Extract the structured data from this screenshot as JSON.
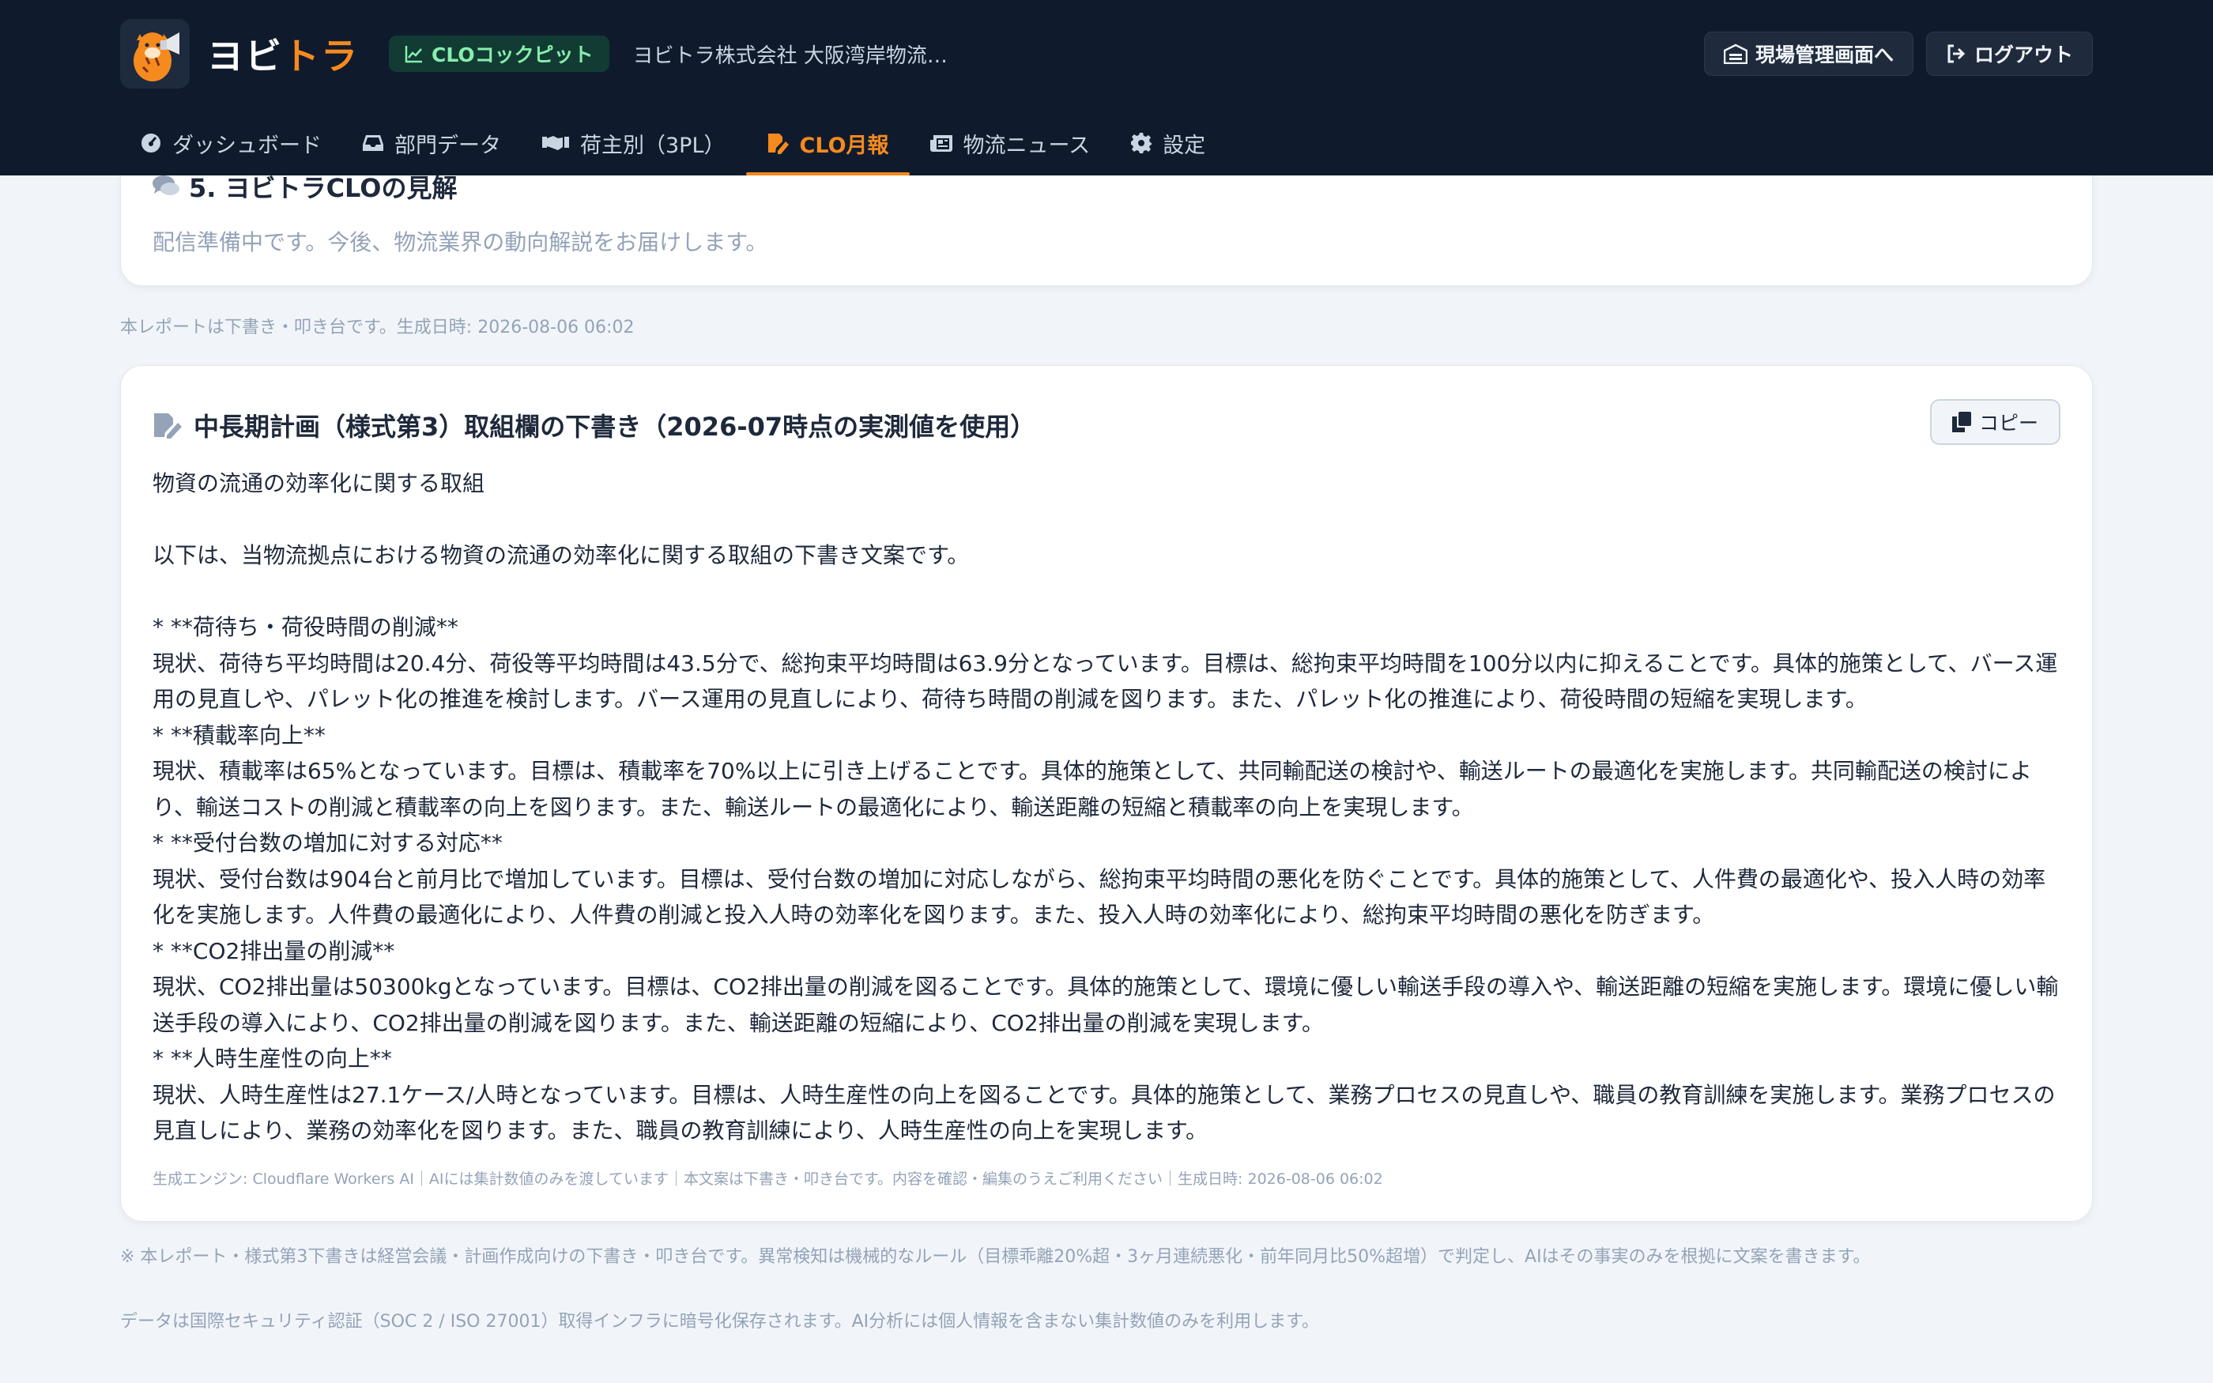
{
  "header": {
    "brand_part1": "ヨビ",
    "brand_part2": "トラ",
    "badge_label": "CLOコックピット",
    "company": "ヨビトラ株式会社 大阪湾岸物流セ...",
    "site_button": "現場管理画面へ",
    "logout_button": "ログアウト"
  },
  "nav": {
    "items": [
      {
        "label": "ダッシュボード",
        "icon": "gauge-icon"
      },
      {
        "label": "部門データ",
        "icon": "inbox-icon"
      },
      {
        "label": "荷主別（3PL）",
        "icon": "handshake-icon"
      },
      {
        "label": "CLO月報",
        "icon": "file-pen-icon",
        "active": true
      },
      {
        "label": "物流ニュース",
        "icon": "newspaper-icon"
      },
      {
        "label": "設定",
        "icon": "gear-icon"
      }
    ]
  },
  "section5": {
    "title": "5. ヨビトラCLOの見解",
    "body": "配信準備中です。今後、物流業界の動向解説をお届けします。"
  },
  "report_meta": "本レポートは下書き・叩き台です。生成日時: 2026-08-06 06:02",
  "draft": {
    "title": "中長期計画（様式第3）取組欄の下書き（2026-07時点の実測値を使用）",
    "copy_button": "コピー",
    "lines": [
      "物資の流通の効率化に関する取組",
      "",
      "以下は、当物流拠点における物資の流通の効率化に関する取組の下書き文案です。",
      "",
      "* **荷待ち・荷役時間の削減**",
      "現状、荷待ち平均時間は20.4分、荷役等平均時間は43.5分で、総拘束平均時間は63.9分となっています。目標は、総拘束平均時間を100分以内に抑えることです。具体的施策として、バース運用の見直しや、パレット化の推進を検討します。バース運用の見直しにより、荷待ち時間の削減を図ります。また、パレット化の推進により、荷役時間の短縮を実現します。",
      "* **積載率向上**",
      "現状、積載率は65%となっています。目標は、積載率を70%以上に引き上げることです。具体的施策として、共同輸配送の検討や、輸送ルートの最適化を実施します。共同輸配送の検討により、輸送コストの削減と積載率の向上を図ります。また、輸送ルートの最適化により、輸送距離の短縮と積載率の向上を実現します。",
      "* **受付台数の増加に対する対応**",
      "現状、受付台数は904台と前月比で増加しています。目標は、受付台数の増加に対応しながら、総拘束平均時間の悪化を防ぐことです。具体的施策として、人件費の最適化や、投入人時の効率化を実施します。人件費の最適化により、人件費の削減と投入人時の効率化を図ります。また、投入人時の効率化により、総拘束平均時間の悪化を防ぎます。",
      "* **CO2排出量の削減**",
      "現状、CO2排出量は50300kgとなっています。目標は、CO2排出量の削減を図ることです。具体的施策として、環境に優しい輸送手段の導入や、輸送距離の短縮を実施します。環境に優しい輸送手段の導入により、CO2排出量の削減を図ります。また、輸送距離の短縮により、CO2排出量の削減を実現します。",
      "* **人時生産性の向上**",
      "現状、人時生産性は27.1ケース/人時となっています。目標は、人時生産性の向上を図ることです。具体的施策として、業務プロセスの見直しや、職員の教育訓練を実施します。業務プロセスの見直しにより、業務の効率化を図ります。また、職員の教育訓練により、人時生産性の向上を実現します。"
    ],
    "footer": "生成エンジン: Cloudflare Workers AI｜AIには集計数値のみを渡しています｜本文案は下書き・叩き台です。内容を確認・編集のうえご利用ください｜生成日時: 2026-08-06 06:02"
  },
  "notes": {
    "note1": "※ 本レポート・様式第3下書きは経営会議・計画作成向けの下書き・叩き台です。異常検知は機械的なルール（目標乖離20%超・3ヶ月連続悪化・前年同月比50%超増）で判定し、AIはその事実のみを根拠に文案を書きます。",
    "note2": "データは国際セキュリティ認証（SOC 2 / ISO 27001）取得インフラに暗号化保存されます。AI分析には個人情報を含まない集計数値のみを利用します。"
  },
  "colors": {
    "header_bg": "#0f1b2d",
    "accent": "#f58a1f",
    "badge_text": "#4ade80",
    "page_bg": "#f1f5f9"
  }
}
